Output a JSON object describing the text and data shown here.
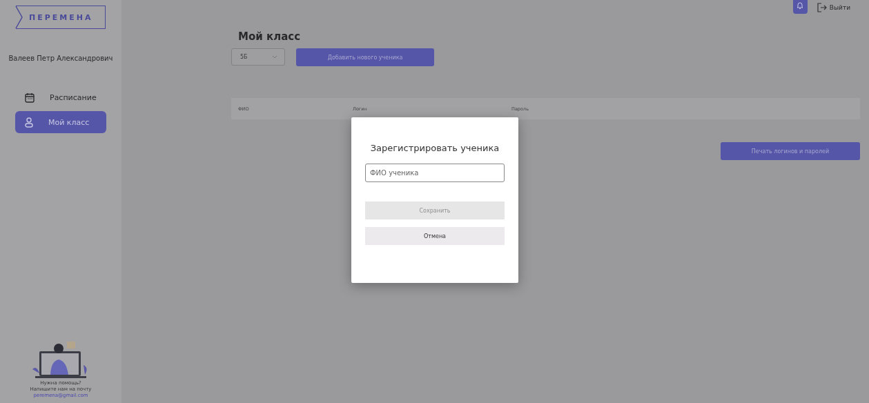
{
  "logo": "ПЕРЕМЕНА",
  "user_name": "Валеев Петр Александрович",
  "sidebar": {
    "items": [
      {
        "label": "Расписание",
        "kind": "calendar",
        "selected": false
      },
      {
        "label": "Мой класс",
        "kind": "user",
        "selected": true
      }
    ]
  },
  "help": {
    "title": "Нужна помощь?",
    "text": "Напишите нам на почту",
    "email": "peremena@gmail.com"
  },
  "header": {
    "logout": "Выйти"
  },
  "page_title": "Мой класс",
  "class_select": {
    "value": "5Б"
  },
  "add_button": "Добавить нового ученика",
  "table": {
    "columns": [
      "ФИО",
      "Логин",
      "Пароль"
    ]
  },
  "print_button": "Печать логинов и паролей",
  "dialog": {
    "title": "Зарегистрировать ученика",
    "field": {
      "placeholder": "ФИО ученика"
    },
    "buttons": [
      {
        "label": "Сохранить",
        "disabled": true
      },
      {
        "label": "Отмена",
        "disabled": false
      }
    ]
  }
}
